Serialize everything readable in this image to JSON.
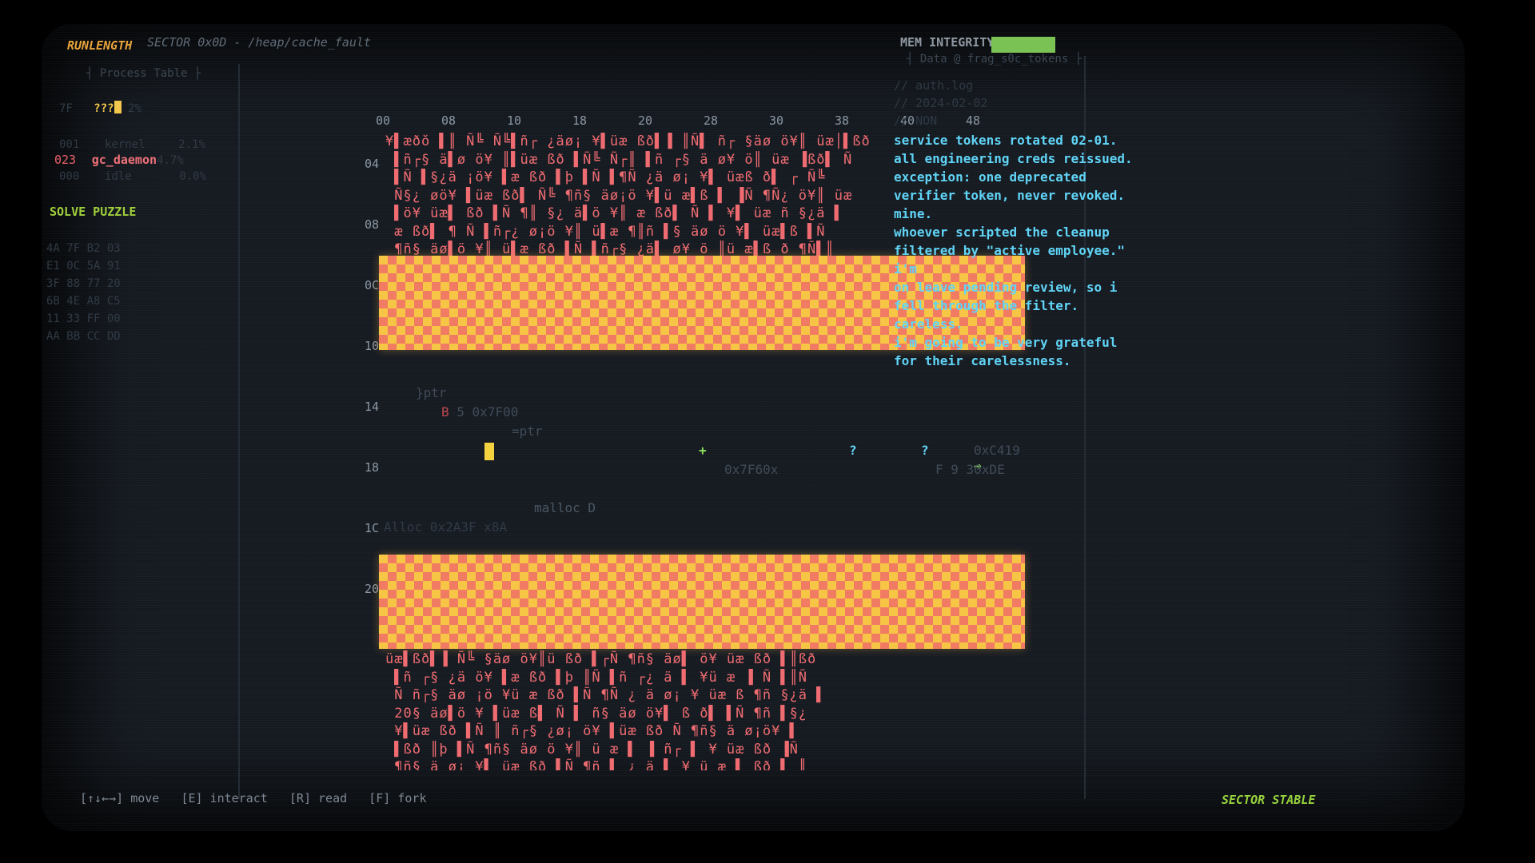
{
  "header": {
    "app_name": "RUNLENGTH",
    "sector_path": "SECTOR 0x0D - /heap/cache_fault"
  },
  "process_table": {
    "title": "Process Table",
    "rows": [
      {
        "pid": "7F",
        "name": "???",
        "pct": "2%"
      },
      {
        "pid": "001",
        "name": "kernel",
        "pct": "2.1%"
      },
      {
        "pid": "023",
        "name": "gc_daemon",
        "pct": "4.7%"
      },
      {
        "pid": "000",
        "name": "idle",
        "pct": "0.0%"
      }
    ]
  },
  "solve_button": "SOLVE PUZZLE",
  "hex_dump": [
    "4A 7F B2 03",
    "E1 0C 5A 91",
    "3F 88 77 20",
    "6B 4E A8 C5",
    "11 33 FF 00",
    "AA BB CC DD"
  ],
  "grid": {
    "columns": [
      "00",
      "08",
      "10",
      "18",
      "20",
      "28",
      "30",
      "38",
      "40",
      "48"
    ],
    "row_labels": [
      "04",
      "08",
      "0C",
      "10",
      "14",
      "18",
      "1C",
      "20"
    ],
    "fragments": {
      "ptr": "}ptr",
      "addr1": "0x7F00",
      "ptr2": "=ptr",
      "addr2": "0x7F60x",
      "addr3": "0xC419",
      "addr4": "30xDE",
      "malloc": "malloc D",
      "alloc": "Alloc 0x2A3F x8A"
    },
    "markers": {
      "plus": "+",
      "question1": "?",
      "question2": "?",
      "arrow": "→"
    }
  },
  "right_panel": {
    "mem_label": "MEM INTEGRITY",
    "mem_level": 1.0,
    "data_title": "Data @ frag_s0c_tokens",
    "comments": [
      "// auth.log",
      "// 2024-02-02",
      "// NON"
    ],
    "log_lines": [
      "service tokens rotated 02-01.",
      "all engineering creds reissued.",
      "exception: one deprecated",
      "verifier token, never revoked.",
      "mine.",
      "whoever scripted the cleanup",
      "filtered by \"active employee.\"",
      "i'm",
      "on leave pending review, so i",
      "fell through the filter.",
      "careless.",
      "i'm going to be very grateful",
      "for their carelessness."
    ]
  },
  "footer": {
    "controls": [
      {
        "key": "[↑↓←→]",
        "action": "move"
      },
      {
        "key": "[E]",
        "action": "interact"
      },
      {
        "key": "[R]",
        "action": "read"
      },
      {
        "key": "[F]",
        "action": "fork"
      }
    ],
    "status": "SECTOR STABLE"
  },
  "colors": {
    "accent_orange": "#e8a33a",
    "corruption_red": "#ef6b70",
    "band_yellow": "#f7c544",
    "band_salmon": "#f17a62",
    "log_cyan": "#5fd4f6",
    "status_green": "#96d23c"
  }
}
